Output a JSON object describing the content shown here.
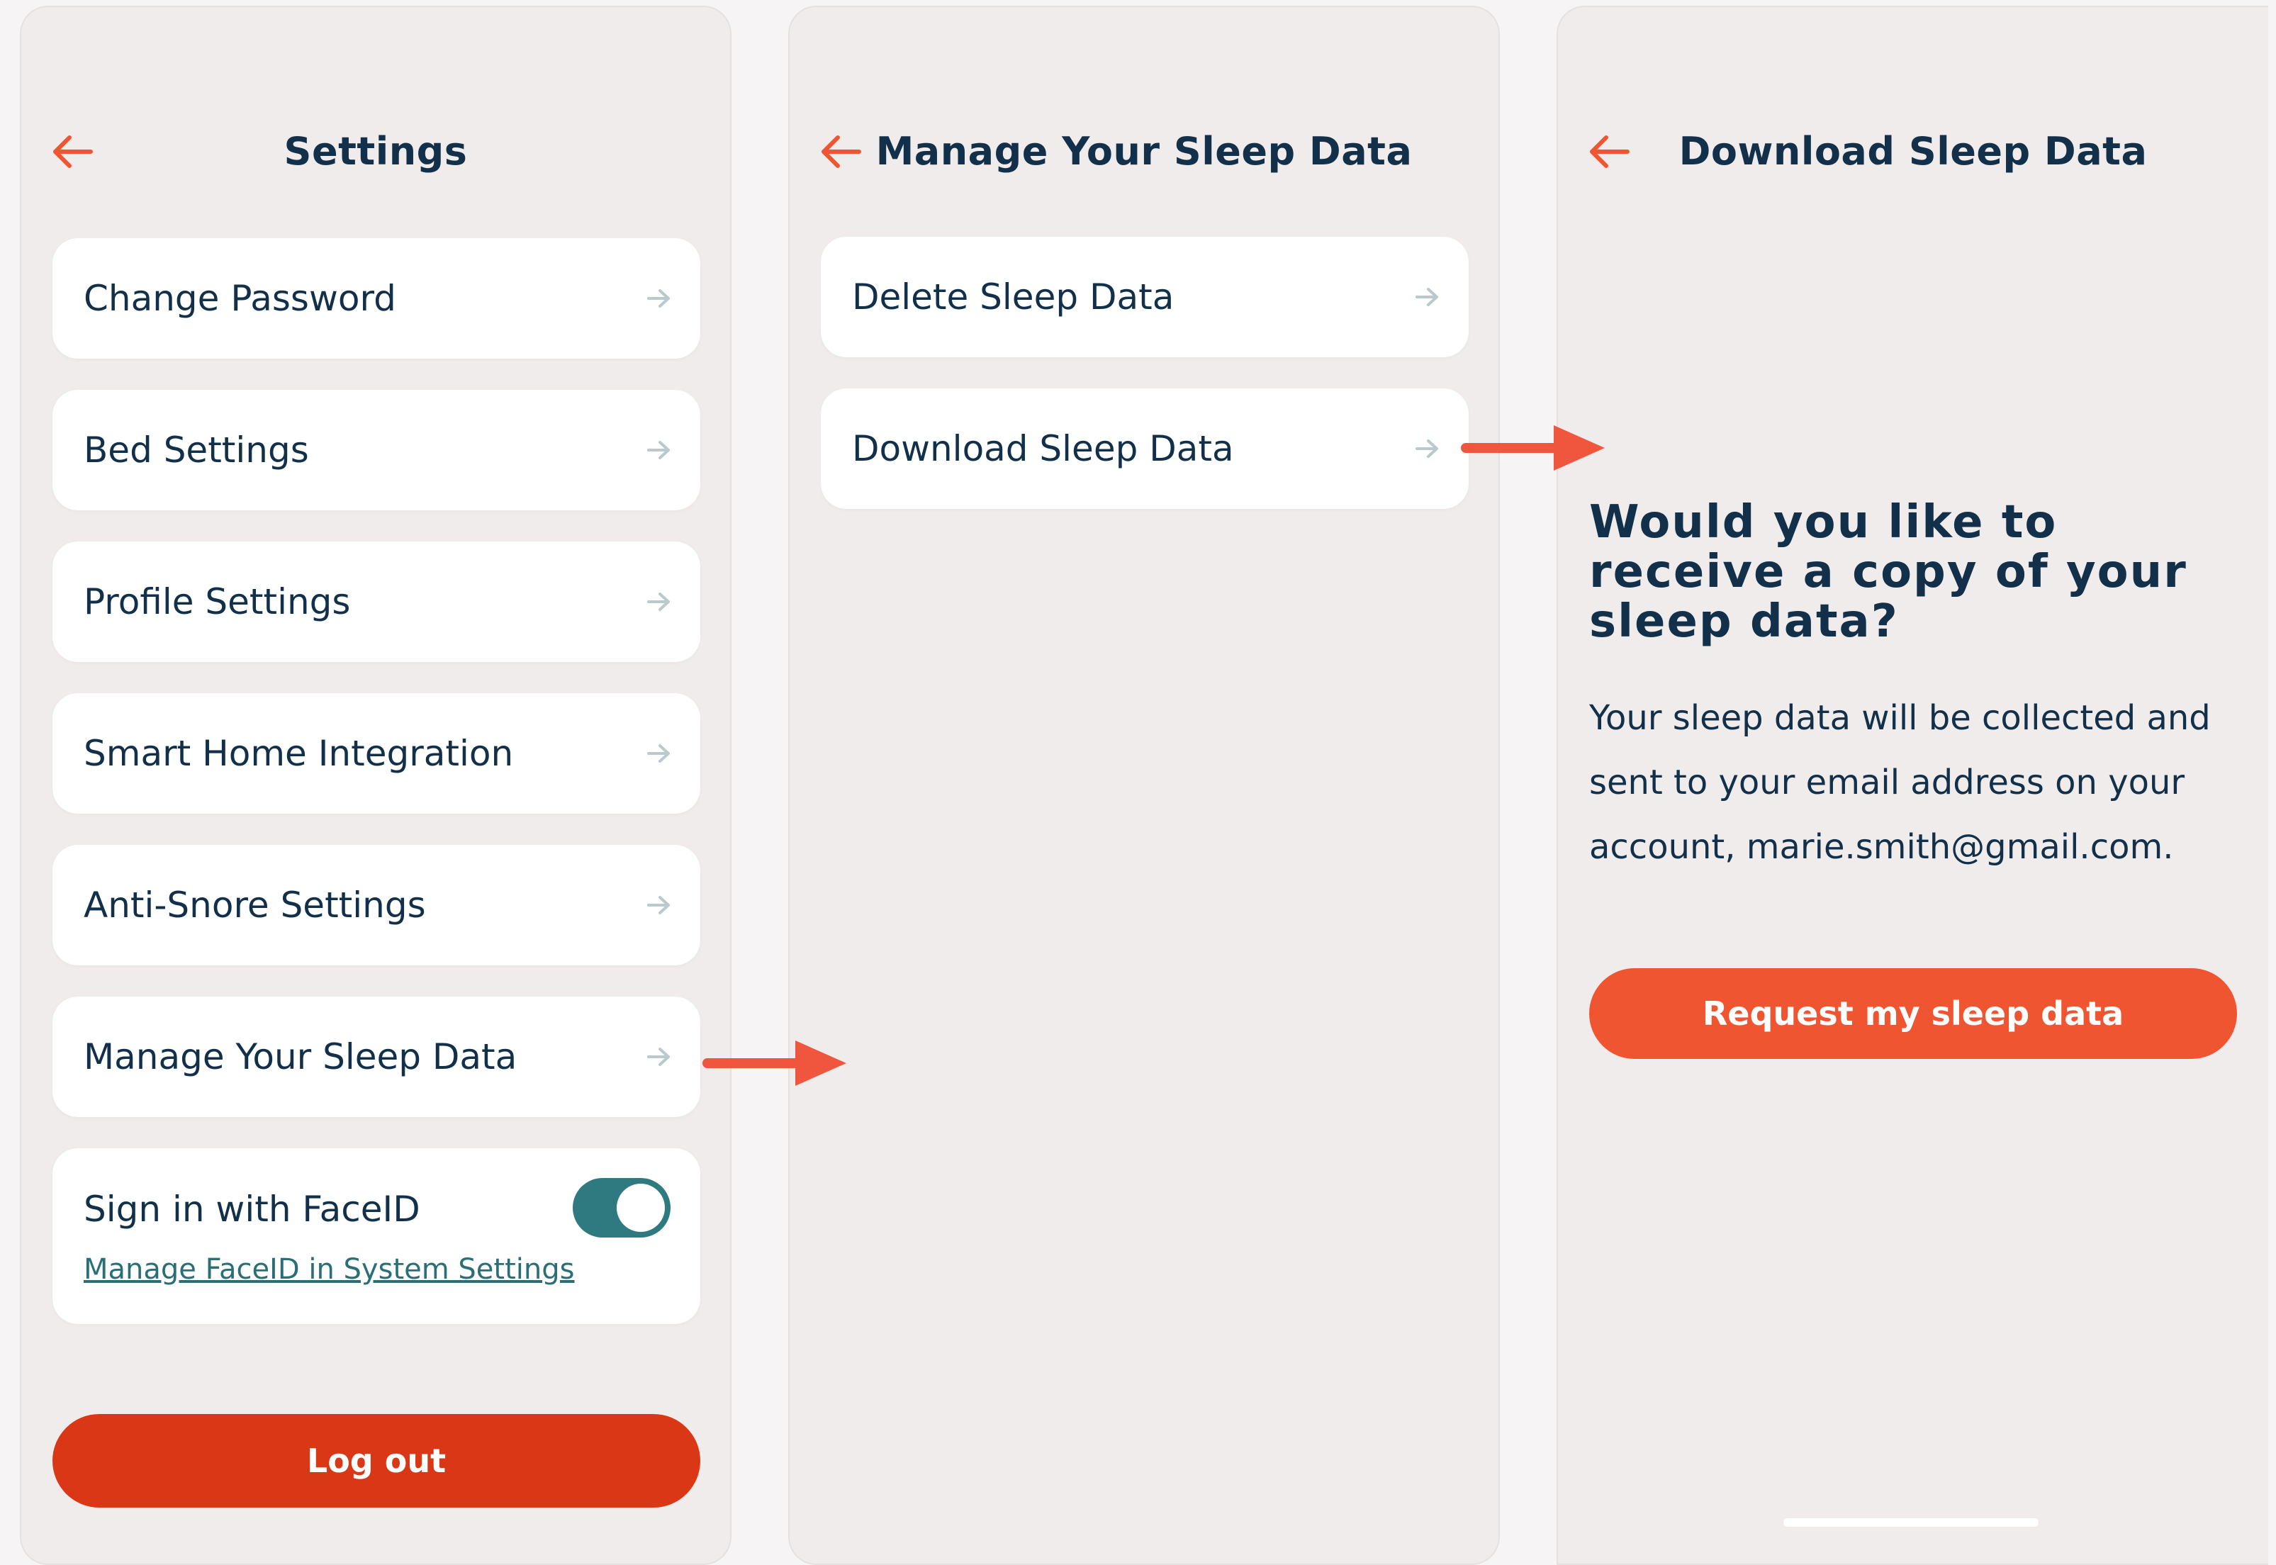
{
  "colors": {
    "accent": "#ef5530",
    "logout": "#d93716",
    "text": "#12304a",
    "toggle_on": "#2f7a80",
    "link": "#2a6e78",
    "screen_bg": "#f1ecec",
    "card_bg": "#ffffff"
  },
  "settings": {
    "title": "Settings",
    "items": [
      {
        "label": "Change Password"
      },
      {
        "label": "Bed Settings"
      },
      {
        "label": "Profile Settings"
      },
      {
        "label": "Smart Home Integration"
      },
      {
        "label": "Anti-Snore Settings"
      },
      {
        "label": "Manage Your Sleep Data"
      }
    ],
    "faceid": {
      "label": "Sign in with FaceID",
      "enabled": true,
      "link": "Manage FaceID in System Settings"
    },
    "logout_label": "Log out"
  },
  "manage": {
    "title": "Manage Your Sleep Data",
    "items": [
      {
        "label": "Delete Sleep Data"
      },
      {
        "label": "Download Sleep Data"
      }
    ]
  },
  "download": {
    "title": "Download Sleep Data",
    "question": "Would you like to receive a copy of your sleep data?",
    "description_lines": [
      "Your sleep data will be collected and",
      "sent to your email address on your",
      "account, marie.smith@gmail.com."
    ],
    "button_label": "Request my sleep data"
  },
  "icons": {
    "back": "arrow-left-icon",
    "chevron": "arrow-right-icon",
    "flow": "flow-arrow-icon"
  }
}
